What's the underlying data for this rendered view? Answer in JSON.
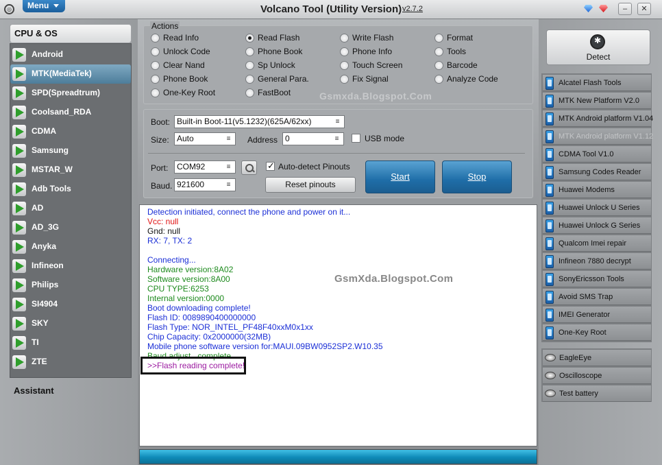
{
  "title": {
    "app": "Volcano Tool (Utility Version)",
    "version": "v2.7.2",
    "menu": "Menu",
    "minimize": "–",
    "close": "✕"
  },
  "left": {
    "header": "CPU & OS",
    "items": [
      "Android",
      "MTK(MediaTek)",
      "SPD(Spreadtrum)",
      "Coolsand_RDA",
      "CDMA",
      "Samsung",
      "MSTAR_W",
      "Adb Tools",
      "AD",
      "AD_3G",
      "Anyka",
      "Infineon",
      "Philips",
      "SI4904",
      "SKY",
      "TI",
      "ZTE"
    ],
    "selected": "MTK(MediaTek)",
    "assistant": "Assistant"
  },
  "actions": {
    "title": "Actions",
    "options": [
      [
        "Read Info",
        "Read Flash",
        "Write Flash",
        "Format"
      ],
      [
        "Unlock Code",
        "Phone Book",
        "Phone Info",
        "Tools"
      ],
      [
        "Clear Nand",
        "Sp Unlock",
        "Touch Screen",
        "Barcode"
      ],
      [
        "Phone Book",
        "General Para.",
        "Fix Signal",
        "Analyze Code"
      ],
      [
        "One-Key Root",
        "FastBoot"
      ]
    ],
    "checked": "Read Flash",
    "watermark": "Gsmxda.Blogspot.Com"
  },
  "boot": {
    "boot_label": "Boot:",
    "boot_value": "Built-in Boot-11(v5.1232)(625A/62xx)",
    "size_label": "Size:",
    "size_value": "Auto",
    "address_label": "Address",
    "address_value": "0",
    "usb_label": "USB mode",
    "usb_checked": false,
    "port_label": "Port:",
    "port_value": "COM92",
    "baud_label": "Baud.",
    "baud_value": "921600",
    "autodetect_label": "Auto-detect Pinouts",
    "autodetect_checked": true,
    "reset_label": "Reset pinouts",
    "start_label": "Start",
    "stop_label": "Stop"
  },
  "log": {
    "lines": [
      {
        "text": "Detection initiated, connect the phone and power on it...",
        "color": "#1a2ed6"
      },
      {
        "text": "Vcc: null",
        "color": "#e01414"
      },
      {
        "text": "Gnd: null",
        "color": "#111111"
      },
      {
        "text": "RX: 7, TX: 2",
        "color": "#1a2ed6"
      },
      {
        "text": "",
        "color": "#111111"
      },
      {
        "text": "Connecting...",
        "color": "#1a2ed6"
      },
      {
        "text": "Hardware version:8A02",
        "color": "#1d8a1d"
      },
      {
        "text": "Software version:8A00",
        "color": "#1d8a1d"
      },
      {
        "text": "CPU TYPE:6253",
        "color": "#1d8a1d"
      },
      {
        "text": "Internal version:0000",
        "color": "#1d8a1d"
      },
      {
        "text": "Boot downloading complete!",
        "color": "#1a2ed6"
      },
      {
        "text": "Flash ID: 0089890400000000",
        "color": "#1a2ed6"
      },
      {
        "text": "Flash Type: NOR_INTEL_PF48F40xxM0x1xx",
        "color": "#1a2ed6"
      },
      {
        "text": "Chip Capacity: 0x2000000(32MB)",
        "color": "#1a2ed6"
      },
      {
        "text": "Mobile phone software version for:MAUI.09BW0952SP2.W10.35",
        "color": "#1a2ed6"
      },
      {
        "text": "Baud adjust...complete",
        "color": "#1d8a1d"
      },
      {
        "text": ">>Flash reading complete!",
        "color": "#9b1aa0"
      }
    ],
    "watermark": "GsmXda.Blogspot.Com"
  },
  "right": {
    "detect_label": "Detect",
    "tools": [
      "Alcatel Flash Tools",
      "MTK New Platform V2.0",
      "MTK Android platform V1.04",
      "MTK Android platform V1.12",
      "CDMA Tool  V1.0",
      "Samsung Codes Reader",
      "Huawei Modems",
      "Huawei Unlock U Series",
      "Huawei Unlock G Series",
      "Qualcom Imei repair",
      "Infineon 7880 decrypt",
      "SonyEricsson Tools",
      "Avoid SMS Trap",
      "IMEI Generator",
      "One-Key Root"
    ],
    "dimmed": "MTK Android platform V1.12",
    "extras": [
      "EagleEye",
      "Oscilloscope",
      "Test battery"
    ]
  },
  "colors": {
    "accent": "#1f6ea8",
    "log_highlight": "#9b1aa0"
  }
}
